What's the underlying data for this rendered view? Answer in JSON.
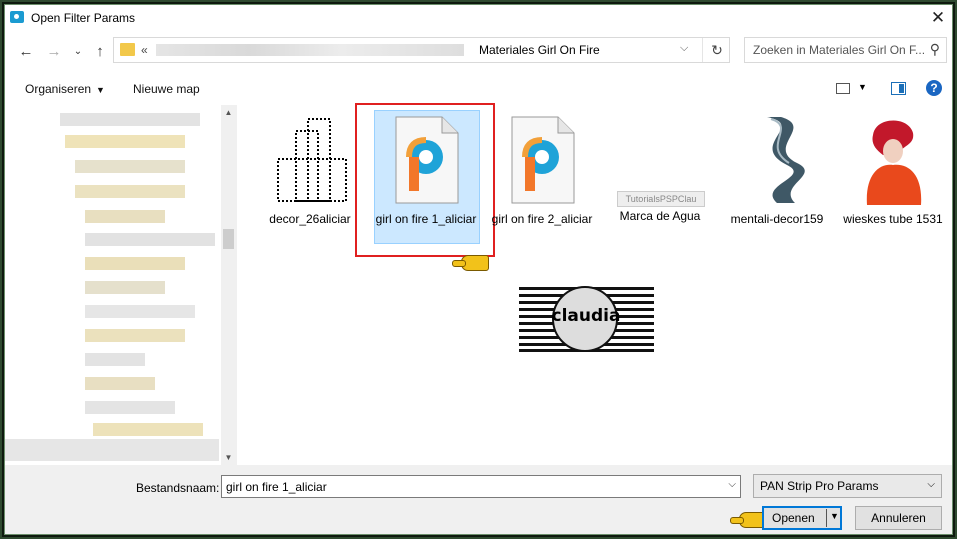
{
  "window": {
    "title": "Open Filter Params"
  },
  "address": {
    "prefix": "«",
    "current_folder": "Materiales Girl On Fire"
  },
  "search": {
    "placeholder": "Zoeken in Materiales Girl On F..."
  },
  "toolbar": {
    "organize": "Organiseren",
    "new_folder": "Nieuwe map"
  },
  "files": [
    {
      "name": "decor_26aliciar",
      "kind": "decor"
    },
    {
      "name": "girl on fire 1_aliciar",
      "kind": "psp",
      "selected": true
    },
    {
      "name": "girl on fire 2_aliciar",
      "kind": "psp"
    },
    {
      "name": "Marca de Agua",
      "kind": "watermark",
      "thumb_text": "TutorialsPSPClau"
    },
    {
      "name": "mentali-decor159",
      "kind": "mentali"
    },
    {
      "name": "wieskes tube 1531",
      "kind": "tube"
    }
  ],
  "extra_thumb": {
    "text": "claudia"
  },
  "bottom": {
    "filename_label": "Bestandsnaam:",
    "filename_value": "girl on fire 1_aliciar",
    "filter_value": "PAN Strip Pro Params",
    "open_label": "Openen",
    "cancel_label": "Annuleren"
  },
  "colors": {
    "accent": "#0078d7",
    "selection": "#cce8ff",
    "highlight_box": "#e02020",
    "folder": "#f2c84a"
  }
}
